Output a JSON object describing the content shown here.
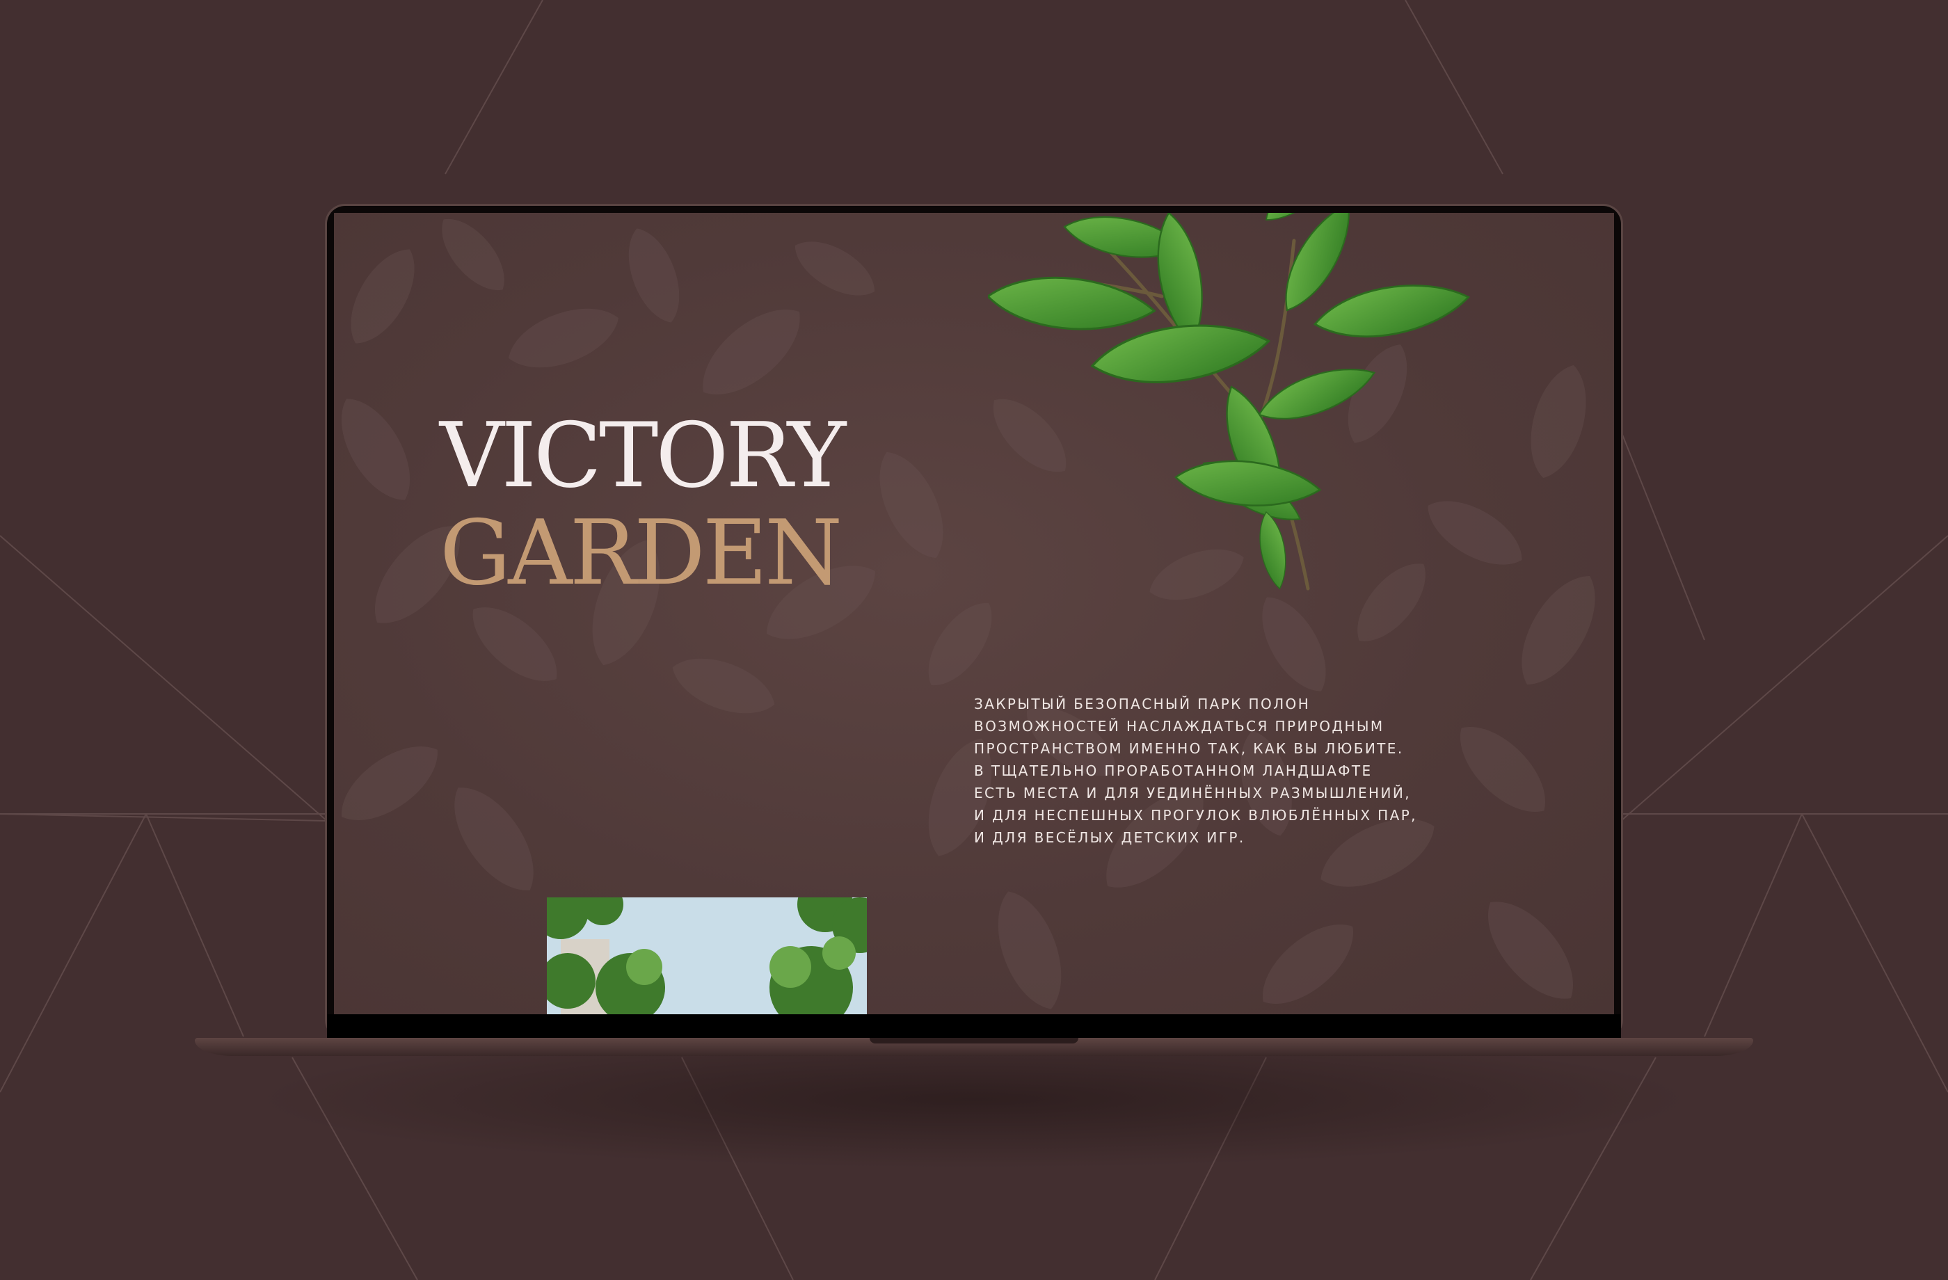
{
  "colors": {
    "background": "#432f30",
    "screen": "#503a39",
    "title_primary": "#f4eded",
    "title_accent": "#c39a73",
    "body_text": "#efe6e3",
    "leaf_green": "#3f8a2c"
  },
  "hero": {
    "title_line1": "VICTORY",
    "title_line2": "GARDEN"
  },
  "description": {
    "lines": [
      "ЗАКРЫТЫЙ БЕЗОПАСНЫЙ ПАРК ПОЛОН",
      "ВОЗМОЖНОСТЕЙ НАСЛАЖДАТЬСЯ ПРИРОДНЫМ",
      "ПРОСТРАНСТВОМ ИМЕННО ТАК, КАК ВЫ ЛЮБИТЕ.",
      "В ТЩАТЕЛЬНО ПРОРАБОТАННОМ ЛАНДШАФТЕ",
      "ЕСТЬ МЕСТА И ДЛЯ УЕДИНЁННЫХ РАЗМЫШЛЕНИЙ,",
      "И ДЛЯ НЕСПЕШНЫХ ПРОГУЛОК ВЛЮБЛЁННЫХ ПАР,",
      "И ДЛЯ ВЕСЁЛЫХ ДЕТСКИХ ИГР."
    ]
  },
  "images": {
    "branch": "green-leaf-branch",
    "photo": "park-trees-photo",
    "texture": "dark-leaves-texture"
  }
}
